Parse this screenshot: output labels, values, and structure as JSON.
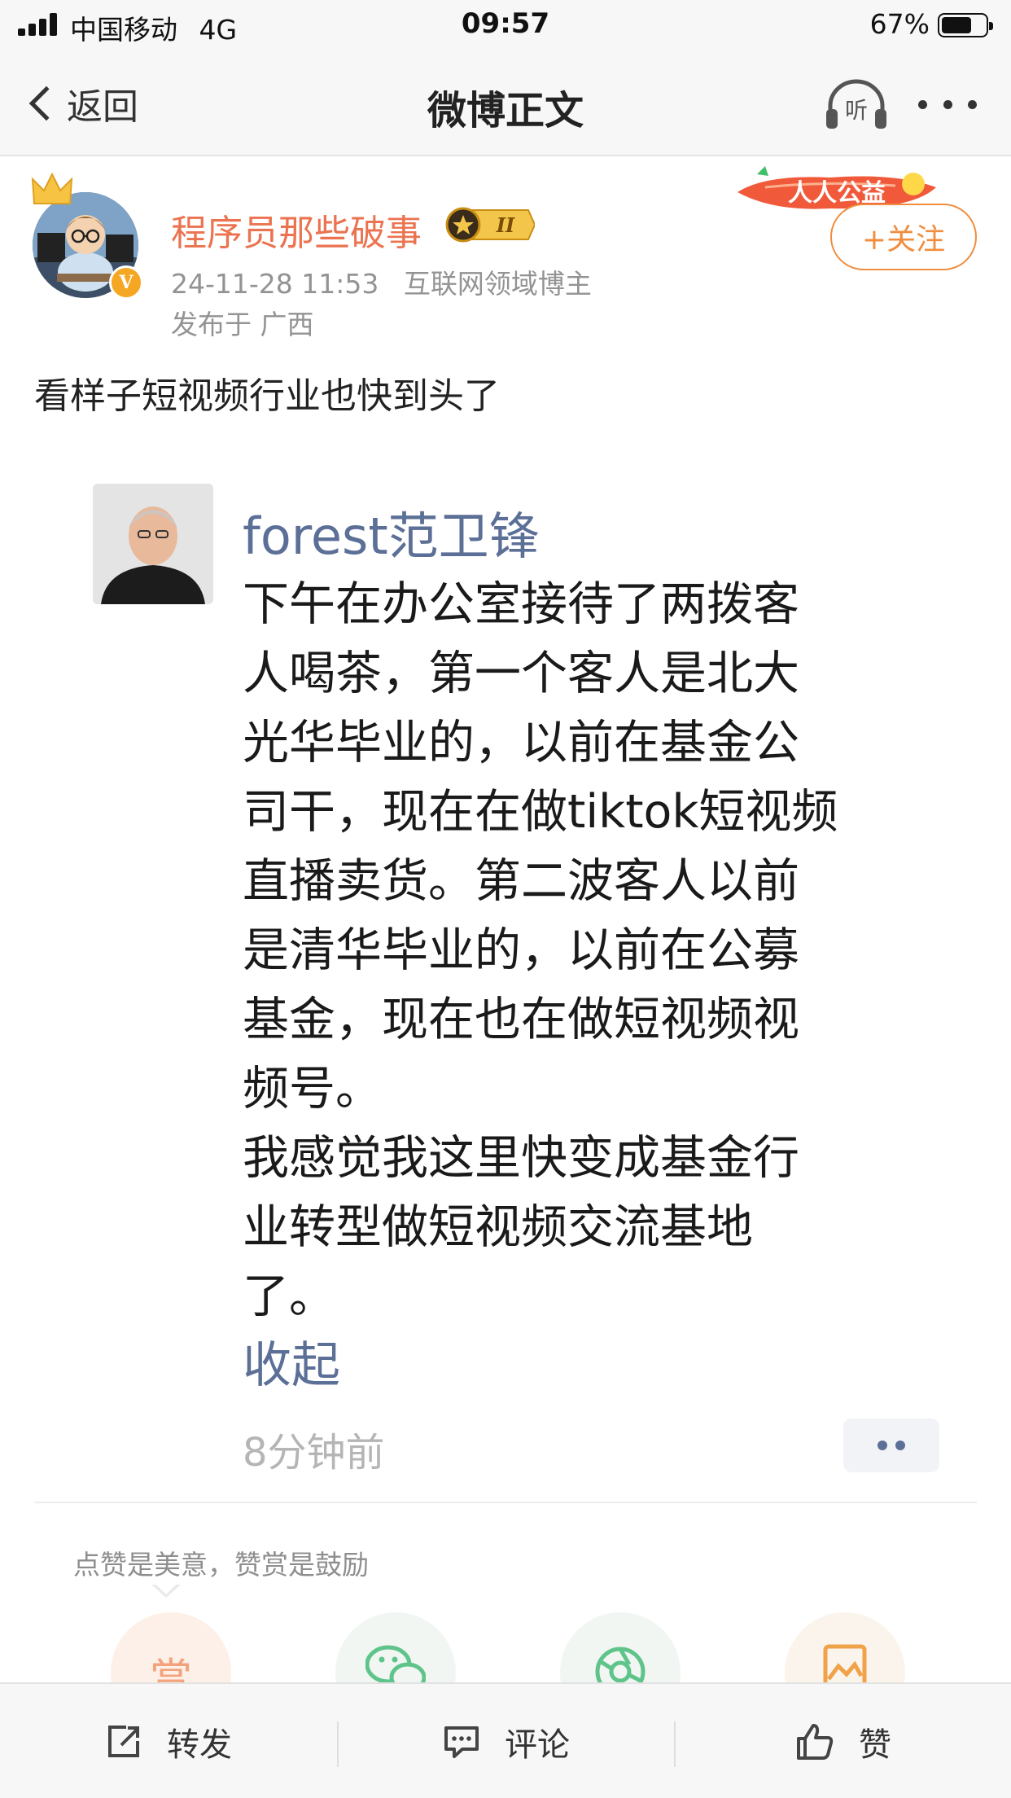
{
  "status_bar": {
    "carrier": "中国移动",
    "network": "4G",
    "time": "09:57",
    "battery_percent": "67%",
    "battery_level": 0.67
  },
  "nav": {
    "back_label": "返回",
    "title": "微博正文",
    "listen_label": "听"
  },
  "post": {
    "author": "程序员那些破事",
    "level_badge": "II",
    "verified_mark": "V",
    "timestamp": "24-11-28 11:53",
    "author_title": "互联网领域博主",
    "location": "发布于 广西",
    "follow_label": "+关注",
    "campaign_banner": "人人公益",
    "text": "看样子短视频行业也快到头了"
  },
  "quoted": {
    "author": "forest范卫锋",
    "body": "下午在办公室接待了两拨客\n人喝茶，第一个客人是北大\n光华毕业的，以前在基金公\n司干，现在在做tiktok短视频\n直播卖货。第二波客人以前\n是清华毕业的，以前在公募\n基金，现在也在做短视频视\n频号。\n我感觉我这里快变成基金行\n业转型做短视频交流基地\n了。",
    "collapse_label": "收起",
    "time_ago": "8分钟前"
  },
  "reward": {
    "tip": "点赞是美意，赞赏是鼓励",
    "buttons": [
      {
        "name": "tip-reward",
        "glyph": "赏",
        "color": "#f3a27c",
        "bg": "#fdf0e8"
      },
      {
        "name": "wechat-share",
        "glyph": "",
        "color": "#5fc48a",
        "bg": "#f1f6f3"
      },
      {
        "name": "moments-share",
        "glyph": "",
        "color": "#5fc48a",
        "bg": "#f1f6f3"
      },
      {
        "name": "image-share",
        "glyph": "",
        "color": "#f0a24a",
        "bg": "#fbf4ec"
      }
    ]
  },
  "toolbar": {
    "repost_label": "转发",
    "comment_label": "评论",
    "like_label": "赞"
  },
  "colors": {
    "author_name": "#eb7350",
    "follow_accent": "#f08d3e",
    "quote_link": "#5c6f97",
    "meta_gray": "#939393"
  }
}
